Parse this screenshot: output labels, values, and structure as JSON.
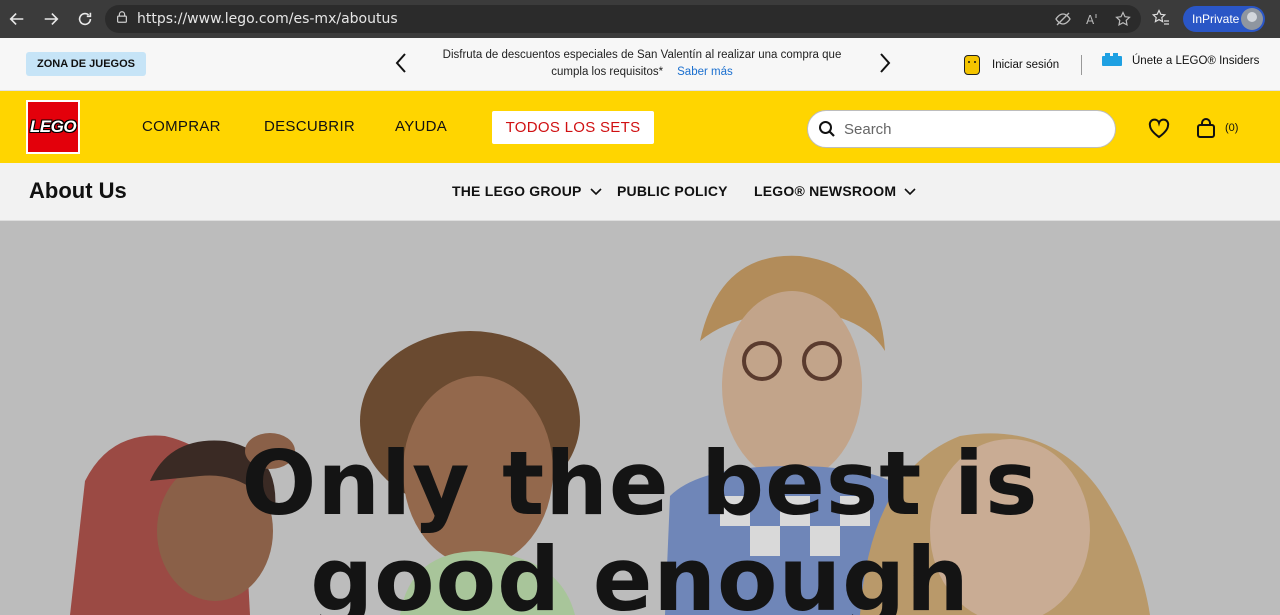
{
  "browser": {
    "url": "https://www.lego.com/es-mx/aboutus",
    "inprivate_label": "InPrivate"
  },
  "promo": {
    "zona_label": "ZONA DE JUEGOS",
    "message_line1": "Disfruta de descuentos especiales de San Valentín al realizar una compra que",
    "message_line2": "cumpla los requisitos*",
    "link_label": "Saber más",
    "login_label": "Iniciar sesión",
    "insiders_label": "Únete a LEGO® Insiders"
  },
  "header": {
    "logo_text": "LEGO",
    "nav": [
      "COMPRAR",
      "DESCUBRIR",
      "AYUDA"
    ],
    "cta_label": "TODOS LOS SETS",
    "search_placeholder": "Search",
    "bag_count": "(0)"
  },
  "subnav": {
    "title": "About Us",
    "items": [
      "THE LEGO GROUP",
      "PUBLIC POLICY",
      "LEGO® NEWSROOM"
    ]
  },
  "hero": {
    "title": "Only the best is good enough"
  },
  "colors": {
    "brand_yellow": "#ffd500",
    "brand_red": "#e3000b",
    "link_blue": "#1a6fcf"
  }
}
